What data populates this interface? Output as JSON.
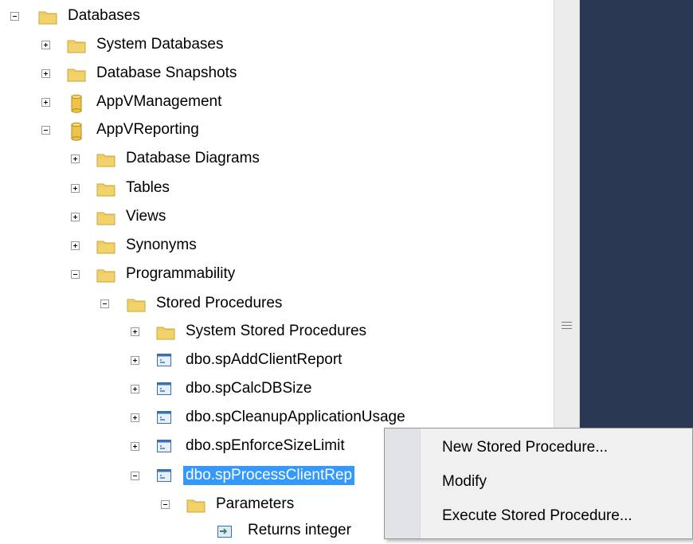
{
  "tree": {
    "databases": "Databases",
    "system_databases": "System Databases",
    "database_snapshots": "Database Snapshots",
    "appv_management": "AppVManagement",
    "appv_reporting": "AppVReporting",
    "database_diagrams": "Database Diagrams",
    "tables": "Tables",
    "views": "Views",
    "synonyms": "Synonyms",
    "programmability": "Programmability",
    "stored_procedures": "Stored Procedures",
    "system_stored_procedures": "System Stored Procedures",
    "sp_add_client_report": "dbo.spAddClientReport",
    "sp_calc_db_size": "dbo.spCalcDBSize",
    "sp_cleanup_application_usage": "dbo.spCleanupApplicationUsage",
    "sp_enforce_size_limit": "dbo.spEnforceSizeLimit",
    "sp_process_client_rep": "dbo.spProcessClientRep",
    "parameters": "Parameters",
    "returns_integer": "Returns integer"
  },
  "context_menu": {
    "new_stored_procedure": "New Stored Procedure...",
    "modify": "Modify",
    "execute_stored_procedure": "Execute Stored Procedure..."
  },
  "colors": {
    "selection": "#3399ff",
    "dark_panel": "#2b3853",
    "folder": "#f2d36b",
    "database": "#f0c24a"
  },
  "icons": {
    "folder": "folder-icon",
    "database": "database-icon",
    "stored_procedure": "stored-procedure-icon",
    "parameter": "parameter-icon"
  }
}
